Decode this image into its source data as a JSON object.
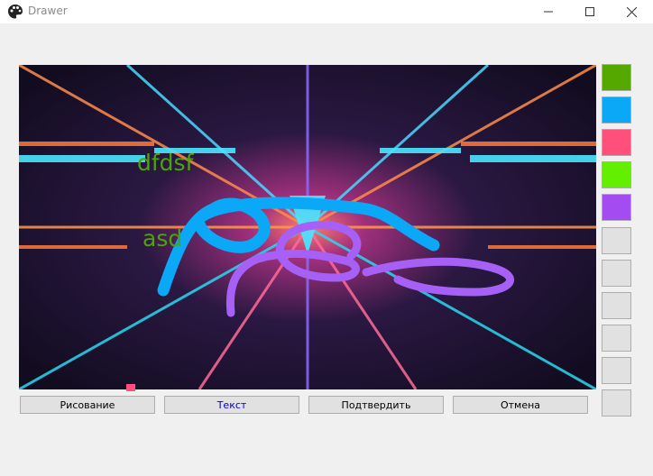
{
  "window": {
    "title": "Drawer"
  },
  "canvas": {
    "texts": [
      {
        "text": "dfdsf",
        "color": "#4ca40a"
      },
      {
        "text": "asd",
        "color": "#4ca40a"
      }
    ],
    "stroke_colors": [
      "#0aa8f6",
      "#a660f6"
    ],
    "marker_color": "#ff4f7a"
  },
  "palette": {
    "colors": [
      "#55a800",
      "#0aa8f6",
      "#ff4f7a",
      "#62f000",
      "#a34cf2"
    ],
    "empty_count": 6
  },
  "buttons": {
    "draw": "Рисование",
    "text": "Текст",
    "confirm": "Подтвердить",
    "cancel": "Отмена",
    "active_color": "#0000c8"
  }
}
